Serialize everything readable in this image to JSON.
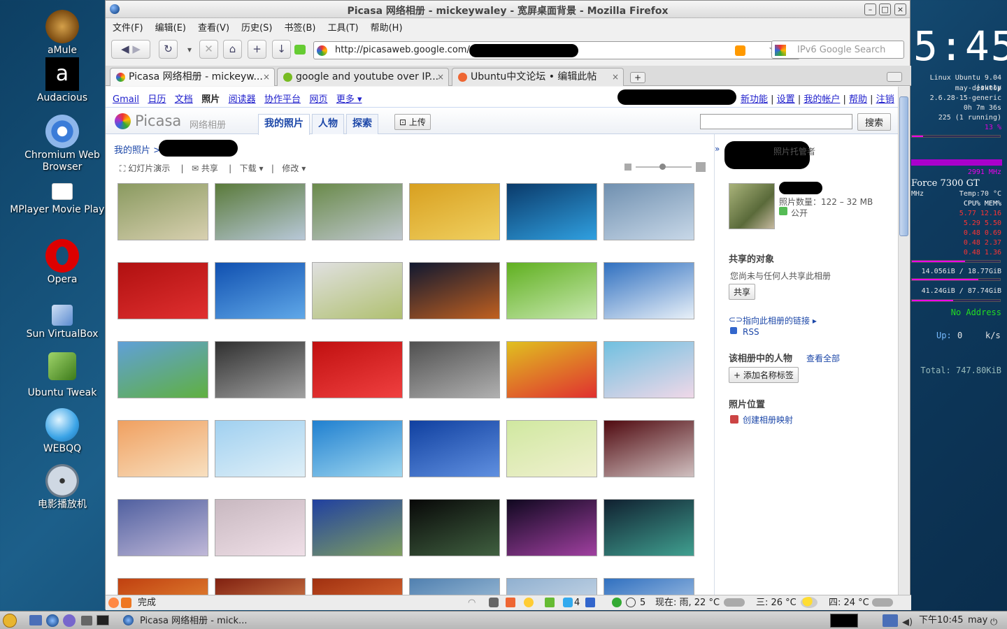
{
  "desktop": {
    "icons": [
      {
        "label": "aMule"
      },
      {
        "label": "Audacious"
      },
      {
        "label": "Chromium Web Browser"
      },
      {
        "label": "MPlayer Movie Player"
      },
      {
        "label": "Opera"
      },
      {
        "label": "Sun VirtualBox"
      },
      {
        "label": "Ubuntu Tweak"
      },
      {
        "label": "WEBQQ"
      },
      {
        "label": "电影播放机"
      }
    ]
  },
  "conky": {
    "clock": "5:45",
    "system": "Linux Ubuntu 9.04 jaunty",
    "host": "may-desktop",
    "kernel": "2.6.28-15-generic",
    "uptime": "0h 7m 36s",
    "procs": "225  (1  running)",
    "cpu_pct": "13 %",
    "cpu_freq": "2991  MHz",
    "gpu": "Force 7300 GT",
    "gpu_mhz": "MHz",
    "gpu_temp": "Temp:70 °C",
    "proc_head": "CPU% MEM%",
    "proc_rows": [
      "5.77  12.16",
      "5.29  5.50",
      "0.48  0.69",
      "0.48  2.37",
      "0.48  1.36"
    ],
    "disk1": "14.056iB  / 18.77GiB",
    "disk2": "41.24GiB  / 87.74GiB",
    "net": "No Address",
    "up_label": "Up:",
    "up_val": "0",
    "up_unit": "k/s",
    "total": "Total: 747.80KiB"
  },
  "window": {
    "title": "Picasa 网络相册 - mickeywaley - 宽屏桌面背景 - Mozilla Firefox",
    "menu": [
      "文件(F)",
      "编辑(E)",
      "查看(V)",
      "历史(S)",
      "书签(B)",
      "工具(T)",
      "帮助(H)"
    ],
    "url": "http://picasaweb.google.com/",
    "search_placeholder": "IPv6 Google Search",
    "tabs": [
      {
        "label": "Picasa 网络相册 - mickeyw...",
        "close": "×"
      },
      {
        "label": "google and youtube over IP...",
        "close": "×"
      },
      {
        "label": "Ubuntu中文论坛 • 编辑此帖",
        "close": "×"
      }
    ]
  },
  "gbar": {
    "left": [
      "Gmail",
      "日历",
      "文档",
      "照片",
      "阅读器",
      "协作平台",
      "网页",
      "更多 ▾"
    ],
    "right": [
      "新功能",
      "设置",
      "我的帐户",
      "帮助",
      "注销"
    ]
  },
  "picasa": {
    "logo": "Picasa",
    "logo_sub": "网络相册",
    "tabs": [
      "我的照片",
      "人物",
      "探索"
    ],
    "upload": "上传",
    "search_button": "搜索",
    "breadcrumb": "我的照片 >",
    "actions": [
      "幻灯片演示",
      "共享",
      "下载 ▾",
      "修改 ▾"
    ]
  },
  "side": {
    "owner_suffix": "照片托管者",
    "album_info": "照片数量：122 – 32 MB",
    "public": "公开",
    "shared_head": "共享的对象",
    "shared_text": "您尚未与任何人共享此相册",
    "share_btn": "共享",
    "link_text": "指向此相册的链接 ▸",
    "rss": "RSS",
    "people_head": "该相册中的人物",
    "view_all": "查看全部",
    "add_tag": "添加名称标签",
    "location_head": "照片位置",
    "create_map": "创建相册映射"
  },
  "status": {
    "text": "完成",
    "twitter": "4",
    "num5": "5",
    "weather_now": "现在: 雨, 22 °C",
    "weather_wed": "三: 26 °C",
    "weather_thu": "四: 24 °C"
  },
  "panel": {
    "task": "Picasa 网络相册 - mick...",
    "time": "下午10:45",
    "user": "may"
  },
  "colors": {
    "accent": "#1c47a8",
    "gbar_link": "#2020cc",
    "conky_bar": "#ee00ee"
  }
}
